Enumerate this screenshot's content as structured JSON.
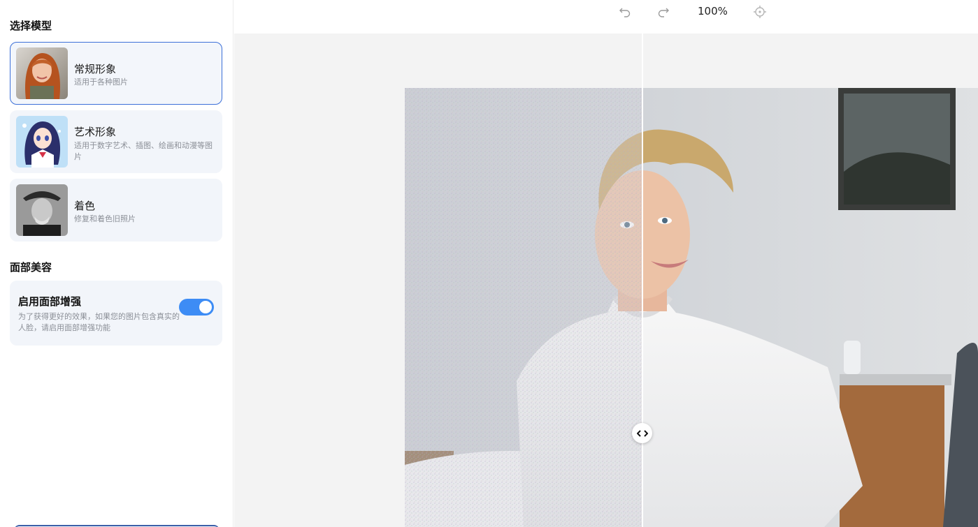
{
  "sidebar": {
    "model_section_title": "选择模型",
    "models": [
      {
        "name": "常规形象",
        "desc": "适用于各种图片",
        "icon": "portrait-woman-thumbnail",
        "selected": true
      },
      {
        "name": "艺术形象",
        "desc": "适用于数字艺术、插图、绘画和动漫等图片",
        "icon": "anime-girl-thumbnail",
        "selected": false
      },
      {
        "name": "着色",
        "desc": "修复和着色旧照片",
        "icon": "old-man-bw-thumbnail",
        "selected": false
      }
    ],
    "face_section_title": "面部美容",
    "face_enhance": {
      "title": "启用面部增强",
      "desc": "为了获得更好的效果，如果您的图片包含真实的人脸，请启用面部增强功能",
      "enabled": true
    }
  },
  "toolbar": {
    "undo_icon": "undo-icon",
    "redo_icon": "redo-icon",
    "zoom": "100%",
    "center_icon": "crosshair-icon"
  },
  "compare": {
    "handle_icon": "arrows-left-right-icon",
    "accent": "#3d8cf5",
    "selected_border": "#3b6fd8"
  }
}
